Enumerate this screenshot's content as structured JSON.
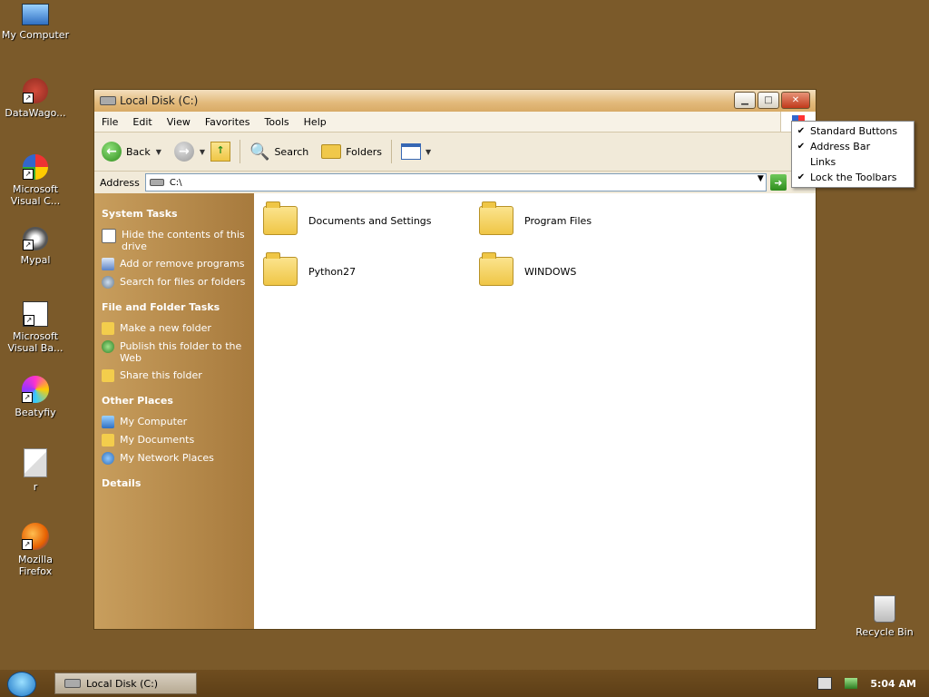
{
  "desktop": {
    "icons": [
      {
        "label": "My Computer",
        "icon": "my-computer-icon"
      },
      {
        "label": "DataWago...",
        "icon": "datawago-icon"
      },
      {
        "label": "Microsoft Visual C...",
        "icon": "visual-c-icon"
      },
      {
        "label": "Mypal",
        "icon": "mypal-icon"
      },
      {
        "label": "Microsoft Visual Ba...",
        "icon": "visual-basic-icon"
      },
      {
        "label": "Beatyfiy",
        "icon": "beatyfiy-icon"
      },
      {
        "label": "r",
        "icon": "python-file-icon"
      },
      {
        "label": "Mozilla Firefox",
        "icon": "firefox-icon"
      },
      {
        "label": "Recycle Bin",
        "icon": "recycle-bin-icon"
      }
    ]
  },
  "window": {
    "title": "Local Disk (C:)",
    "menu": [
      "File",
      "Edit",
      "View",
      "Favorites",
      "Tools",
      "Help"
    ],
    "toolbar": {
      "back": "Back",
      "search": "Search",
      "folders": "Folders"
    },
    "address": {
      "label": "Address",
      "value": "C:\\"
    },
    "task_pane": {
      "system_tasks": {
        "title": "System Tasks",
        "items": [
          "Hide the contents of this drive",
          "Add or remove programs",
          "Search for files or folders"
        ]
      },
      "file_folder_tasks": {
        "title": "File and Folder Tasks",
        "items": [
          "Make a new folder",
          "Publish this folder to the Web",
          "Share this folder"
        ]
      },
      "other_places": {
        "title": "Other Places",
        "items": [
          "My Computer",
          "My Documents",
          "My Network Places"
        ]
      },
      "details": {
        "title": "Details"
      }
    },
    "folders": [
      "Documents and Settings",
      "Program Files",
      "Python27",
      "WINDOWS"
    ]
  },
  "context_menu": {
    "items": [
      {
        "label": "Standard Buttons",
        "checked": true
      },
      {
        "label": "Address Bar",
        "checked": true
      },
      {
        "label": "Links",
        "checked": false
      },
      {
        "label": "Lock the Toolbars",
        "checked": true
      }
    ]
  },
  "taskbar": {
    "task_button": "Local Disk (C:)",
    "clock": "5:04 AM"
  }
}
